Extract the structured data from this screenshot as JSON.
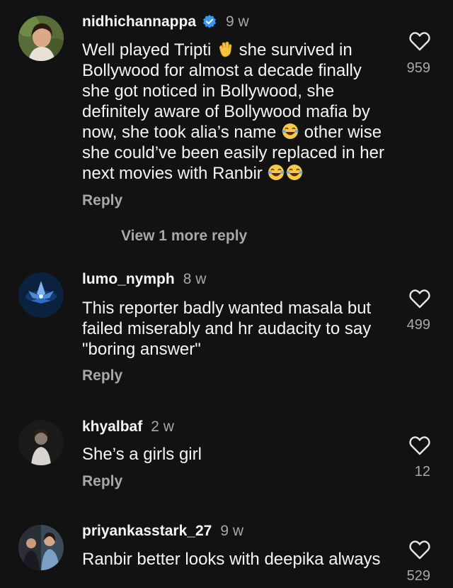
{
  "comments": [
    {
      "username": "nidhichannappa",
      "verified": true,
      "time": "9 w",
      "text_parts": [
        "Well played Tripti ",
        " she survived in Bollywood for almost a decade finally she got noticed in Bollywood, she definitely aware of Bollywood mafia by now, she took alia’s name ",
        " other wise she could’ve been easily replaced in her next movies with Ranbir "
      ],
      "likes": "959",
      "reply_label": "Reply",
      "view_more": "View 1 more reply"
    },
    {
      "username": "lumo_nymph",
      "verified": false,
      "time": "8 w",
      "text": "This reporter badly wanted masala but failed miserably and hr audacity to say \"boring answer\"",
      "likes": "499",
      "reply_label": "Reply"
    },
    {
      "username": "khyalbaf",
      "verified": false,
      "time": "2 w",
      "text": "She’s a girls girl",
      "likes": "12",
      "reply_label": "Reply"
    },
    {
      "username": "priyankasstark_27",
      "verified": false,
      "time": "9 w",
      "text": "Ranbir better looks with deepika always",
      "likes": "529"
    }
  ],
  "colors": {
    "background": "#121212",
    "text": "#f5f5f5",
    "muted": "#a8a8a8",
    "verified": "#3897f0"
  },
  "icons": {
    "like": "heart-outline-icon",
    "verified": "verified-badge-icon",
    "emoji_wave": "waving-hand-emoji",
    "emoji_laugh": "tears-of-joy-emoji"
  }
}
